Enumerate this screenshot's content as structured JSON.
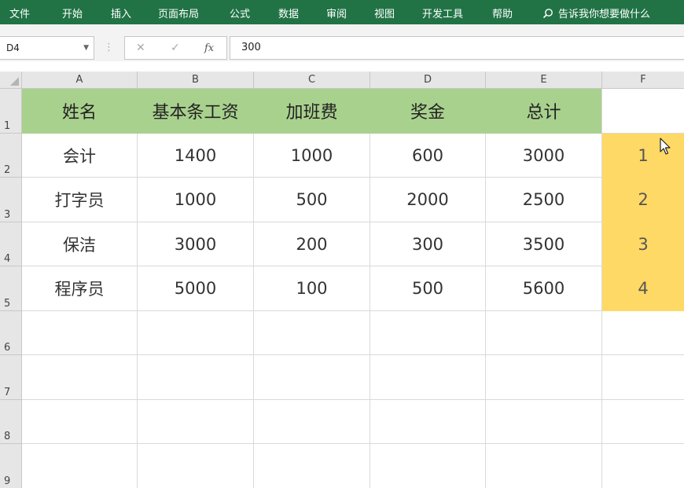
{
  "ribbon": {
    "tabs": [
      "文件",
      "开始",
      "插入",
      "页面布局",
      "公式",
      "数据",
      "审阅",
      "视图",
      "开发工具",
      "帮助"
    ],
    "tell_me": "告诉我你想要做什么",
    "color": "#217346"
  },
  "formula_bar": {
    "name_box": "D4",
    "cancel_icon": "✕",
    "enter_icon": "✓",
    "fx_label": "fx",
    "formula": "300"
  },
  "columns": [
    "A",
    "B",
    "C",
    "D",
    "E",
    "F"
  ],
  "rows": [
    "1",
    "2",
    "3",
    "4",
    "5",
    "6",
    "7",
    "8",
    "9"
  ],
  "table": {
    "headers": [
      "姓名",
      "基本条工资",
      "加班费",
      "奖金",
      "总计"
    ],
    "data": [
      [
        "会计",
        "1400",
        "1000",
        "600",
        "3000"
      ],
      [
        "打字员",
        "1000",
        "500",
        "2000",
        "2500"
      ],
      [
        "保洁",
        "3000",
        "200",
        "300",
        "3500"
      ],
      [
        "程序员",
        "5000",
        "100",
        "500",
        "5600"
      ]
    ],
    "f_column": [
      "1",
      "2",
      "3",
      "4"
    ],
    "header_color": "#a9d18e",
    "highlight_color": "#ffd966"
  }
}
